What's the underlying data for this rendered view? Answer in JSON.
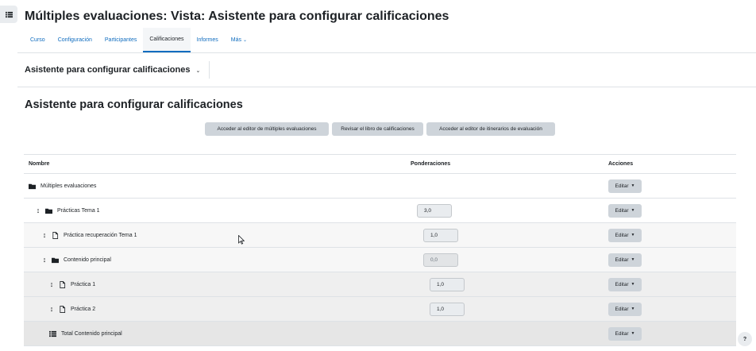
{
  "page": {
    "title": "Múltiples evaluaciones: Vista: Asistente para configurar calificaciones"
  },
  "nav": {
    "tabs": [
      {
        "label": "Curso"
      },
      {
        "label": "Configuración"
      },
      {
        "label": "Participantes"
      },
      {
        "label": "Calificaciones"
      },
      {
        "label": "Informes"
      },
      {
        "label": "Más"
      }
    ]
  },
  "selector": {
    "label": "Asistente para configurar calificaciones"
  },
  "heading": "Asistente para configurar calificaciones",
  "buttons": {
    "editor_multiples": "Acceder al editor de múltiples evaluaciones",
    "revisar_libro": "Revisar el libro de calificaciones",
    "editor_itinerarios": "Acceder al editor de itinerarios de evaluación"
  },
  "table": {
    "headers": {
      "name": "Nombre",
      "weights": "Ponderaciones",
      "actions": "Acciones"
    },
    "rows": [
      {
        "name": "Múltiples evaluaciones",
        "icon": "folder-icon",
        "weight": "",
        "action": "Editar"
      },
      {
        "name": "Prácticas Tema 1",
        "icon": "folder-icon",
        "weight": "3,0",
        "action": "Editar"
      },
      {
        "name": "Práctica recuperación Tema 1",
        "icon": "document-icon",
        "weight": "1,0",
        "action": "Editar"
      },
      {
        "name": "Contenido principal",
        "icon": "folder-icon",
        "weight": "0,0",
        "action": "Editar"
      },
      {
        "name": "Práctica 1",
        "icon": "document-icon",
        "weight": "1,0",
        "action": "Editar"
      },
      {
        "name": "Práctica 2",
        "icon": "document-icon",
        "weight": "1,0",
        "action": "Editar"
      },
      {
        "name": "Total Contenido principal",
        "icon": "list-icon",
        "weight": "",
        "action": "Editar"
      }
    ]
  },
  "help": {
    "label": "?"
  }
}
